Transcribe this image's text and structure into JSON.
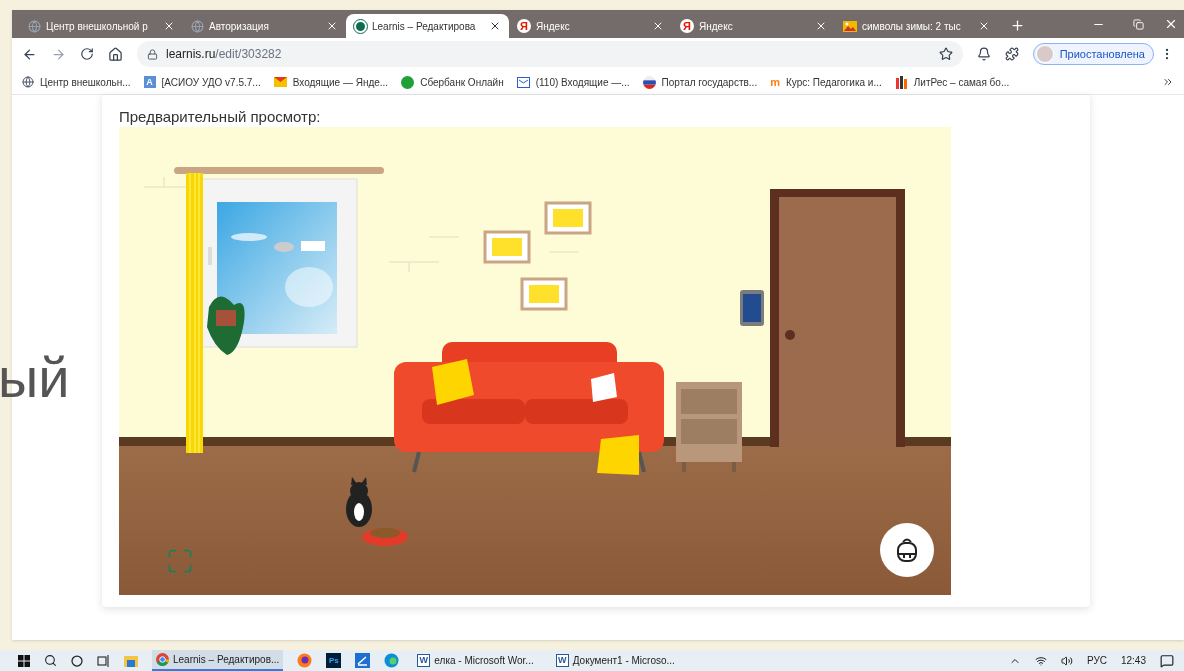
{
  "background_text": "ый",
  "tabs": [
    {
      "title": "Центр внешкольной р",
      "kind": "globe",
      "selected": false
    },
    {
      "title": "Авторизация",
      "kind": "globe",
      "selected": false
    },
    {
      "title": "Learnis – Редактирова",
      "kind": "learnis",
      "selected": true
    },
    {
      "title": "Яндекс",
      "kind": "yandex",
      "badge": "Я",
      "selected": false
    },
    {
      "title": "Яндекс",
      "kind": "yandex",
      "badge": "Я",
      "selected": false
    },
    {
      "title": "символы зимы: 2 тыс",
      "kind": "image",
      "selected": false
    }
  ],
  "address_bar": {
    "host": "learnis.ru",
    "path": "/edit/303282"
  },
  "profile_button": "Приостановлена",
  "bookmarks": [
    {
      "title": "Центр внешкольн...",
      "kind": "globe"
    },
    {
      "title": "[АСИОУ УДО v7.5.7...",
      "kind": "letter",
      "badge": "A"
    },
    {
      "title": "Входящие — Янде...",
      "kind": "mail"
    },
    {
      "title": "Сбербанк Онлайн",
      "kind": "sber"
    },
    {
      "title": "(110) Входящие —...",
      "kind": "mailblue"
    },
    {
      "title": "Портал государств...",
      "kind": "flag"
    },
    {
      "title": "Курс: Педагогика и...",
      "kind": "moodle",
      "badge": "m"
    },
    {
      "title": "ЛитРес – самая бо...",
      "kind": "litres"
    }
  ],
  "preview_label": "Предварительный просмотр:",
  "taskbar": {
    "apps": [
      {
        "kind": "explorer"
      },
      {
        "kind": "chrome",
        "title": "Learnis – Редактиров...",
        "selected": true
      },
      {
        "kind": "firefox"
      },
      {
        "kind": "photoshop",
        "badge": "Ps"
      },
      {
        "kind": "blue"
      },
      {
        "kind": "edge"
      },
      {
        "kind": "word",
        "badge": "W",
        "title": "елка - Microsoft Wor..."
      },
      {
        "kind": "word",
        "badge": "W",
        "title": "Документ1 - Microso..."
      }
    ],
    "language": "РУС",
    "time": "12:43"
  }
}
